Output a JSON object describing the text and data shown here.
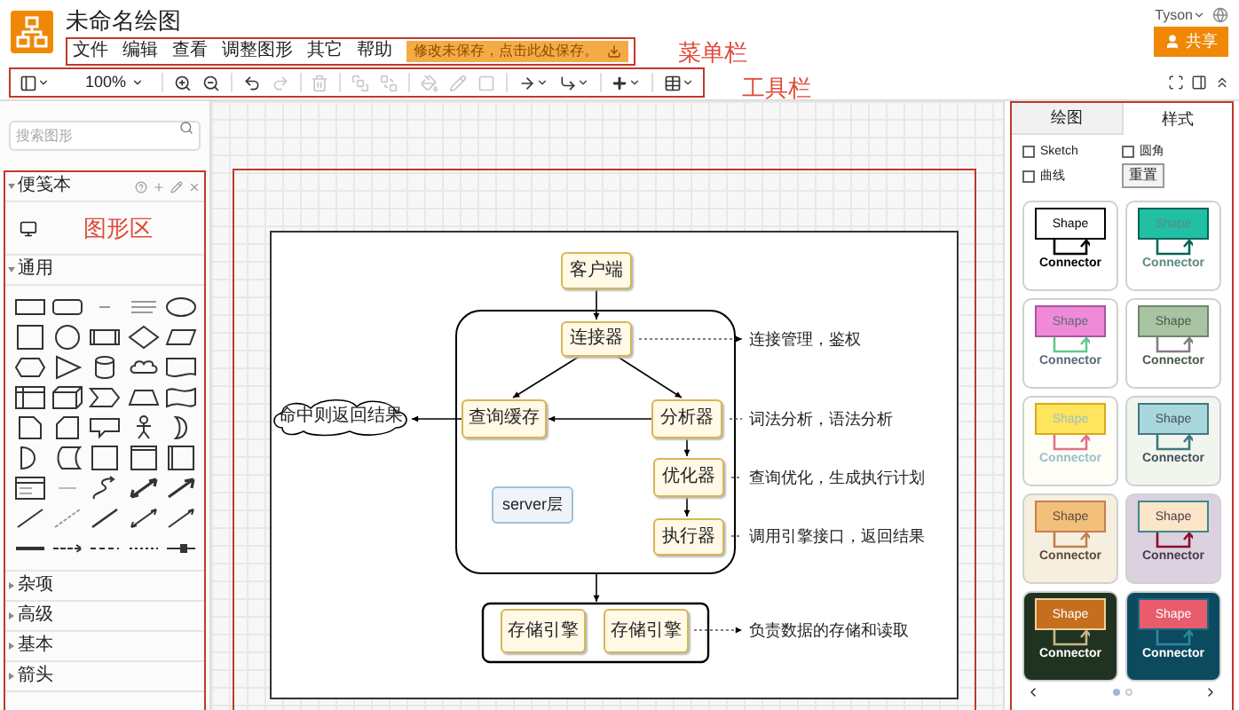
{
  "app": {
    "title": "未命名绘图",
    "user": "Tyson",
    "share_button": "共享"
  },
  "menu": {
    "items": [
      "文件",
      "编辑",
      "查看",
      "调整图形",
      "其它",
      "帮助"
    ],
    "save_notice": "修改未保存，点击此处保存。"
  },
  "toolbar": {
    "zoom": "100%",
    "buttons": [
      {
        "disabled": false
      },
      {
        "disabled": false
      },
      {
        "disabled": false
      },
      {
        "disabled": false
      },
      {
        "disabled": true
      },
      {
        "disabled": true
      },
      {
        "disabled": true
      },
      {
        "disabled": true
      },
      {
        "disabled": true
      },
      {
        "disabled": true
      },
      {
        "disabled": true
      },
      {
        "disabled": false
      },
      {
        "disabled": false
      },
      {
        "disabled": false
      },
      {
        "disabled": false
      }
    ]
  },
  "annotations": {
    "menu": "菜单栏",
    "toolbar": "工具栏",
    "shapes": "图形区"
  },
  "sidebar": {
    "search": {
      "placeholder": "搜索图形"
    },
    "sections": [
      {
        "title": "便笺本",
        "expanded": true
      },
      {
        "title": "通用",
        "expanded": true
      },
      {
        "title": "杂项",
        "expanded": false
      },
      {
        "title": "高级",
        "expanded": false
      },
      {
        "title": "基本",
        "expanded": false
      },
      {
        "title": "箭头",
        "expanded": false
      }
    ]
  },
  "diagram": {
    "nodes": [
      {
        "text": "客户端",
        "kind": "process"
      },
      {
        "text": "连接器",
        "kind": "process"
      },
      {
        "text": "查询缓存",
        "kind": "process"
      },
      {
        "text": "分析器",
        "kind": "process"
      },
      {
        "text": "优化器",
        "kind": "process"
      },
      {
        "text": "执行器",
        "kind": "process"
      },
      {
        "text": "server层",
        "kind": "label"
      },
      {
        "text": "命中则返回结果",
        "kind": "cloud"
      },
      {
        "text": "存储引擎",
        "kind": "process"
      },
      {
        "text": "存储引擎",
        "kind": "process"
      }
    ],
    "notes": [
      "连接管理，鉴权",
      "词法分析，语法分析",
      "查询优化，生成执行计划",
      "调用引擎接口，返回结果",
      "负责数据的存储和读取"
    ]
  },
  "format_panel": {
    "tabs": [
      {
        "label": "绘图",
        "selected": false
      },
      {
        "label": "样式",
        "selected": true
      }
    ],
    "options": [
      {
        "label": "Sketch",
        "checked": false
      },
      {
        "label": "圆角",
        "checked": false
      },
      {
        "label": "曲线",
        "checked": false
      }
    ],
    "reset_button": "重置",
    "styles": [
      {
        "shape": "Shape",
        "connector_label": "Connector",
        "color": "#ffffff"
      },
      {
        "shape": "Shape",
        "connector_label": "Connector",
        "color": "#21c0a5"
      },
      {
        "shape": "Shape",
        "connector_label": "Connector",
        "color": "#f08ad8"
      },
      {
        "shape": "Shape",
        "connector_label": "Connector",
        "color": "#a9c4a3"
      },
      {
        "shape": "Shape",
        "connector_label": "Connector",
        "color": "#ffe45e"
      },
      {
        "shape": "Shape",
        "connector_label": "Connector",
        "color": "#a8d8dd"
      },
      {
        "shape": "Shape",
        "connector_label": "Connector",
        "color": "#f3c07c"
      },
      {
        "shape": "Shape",
        "connector_label": "Connector",
        "color": "#fde5c9"
      },
      {
        "shape": "Shape",
        "connector_label": "Connector",
        "color": "#c46e1e"
      },
      {
        "shape": "Shape",
        "connector_label": "Connector",
        "color": "#e85c6b"
      }
    ],
    "pages": [
      {
        "selected": true
      },
      {
        "selected": false
      }
    ]
  }
}
